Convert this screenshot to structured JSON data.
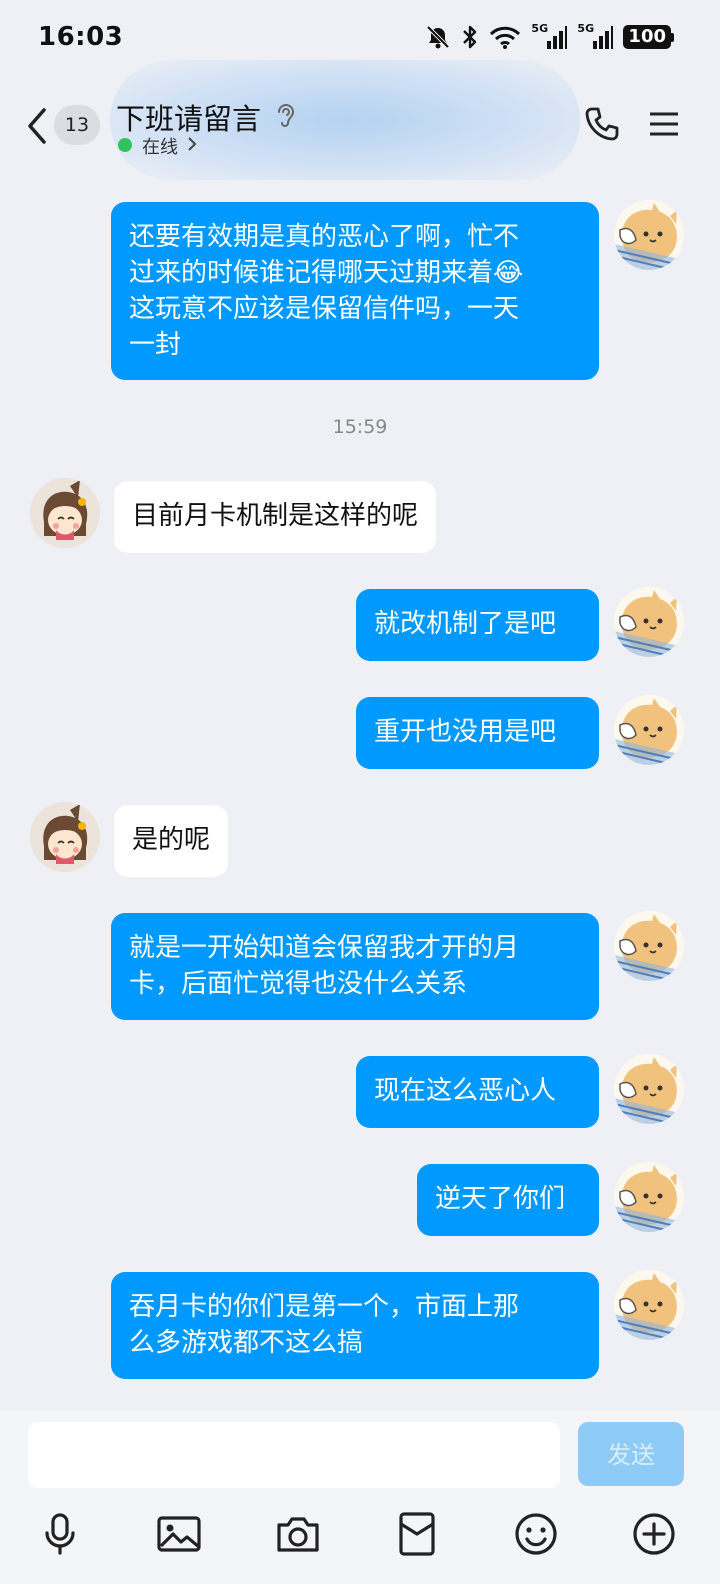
{
  "status_bar": {
    "time": "16:03",
    "network_1": "5G",
    "network_2": "5G",
    "battery": "100"
  },
  "header": {
    "back_badge": "13",
    "title": "下班请留言",
    "online_status": "在线"
  },
  "messages": [
    {
      "from": "me",
      "lines": [
        "还要有效期是真的恶心了啊，忙不",
        "过来的时候谁记得哪天过期来着😂",
        "这玩意不应该是保留信件吗，一天",
        "一封"
      ]
    },
    {
      "type": "time",
      "text": "15:59"
    },
    {
      "from": "other",
      "lines": [
        "目前月卡机制是这样的呢"
      ]
    },
    {
      "from": "me",
      "lines": [
        "就改机制了是吧"
      ]
    },
    {
      "from": "me",
      "lines": [
        "重开也没用是吧"
      ]
    },
    {
      "from": "other",
      "lines": [
        "是的呢"
      ]
    },
    {
      "from": "me",
      "lines": [
        "就是一开始知道会保留我才开的月",
        "卡，后面忙觉得也没什么关系"
      ]
    },
    {
      "from": "me",
      "lines": [
        "现在这么恶心人"
      ]
    },
    {
      "from": "me",
      "lines": [
        "逆天了你们"
      ]
    },
    {
      "from": "me",
      "lines": [
        "吞月卡的你们是第一个，市面上那",
        "么多游戏都不这么搞"
      ]
    }
  ],
  "input": {
    "placeholder": "",
    "send_label": "发送"
  },
  "toolbar": [
    "mic-icon",
    "image-icon",
    "camera-icon",
    "red-packet-icon",
    "emoji-icon",
    "plus-icon"
  ],
  "colors": {
    "bubble_out": "#0099ff",
    "bubble_in": "#ffffff",
    "send_disabled": "#8ecbf6",
    "online": "#2fc45a"
  }
}
